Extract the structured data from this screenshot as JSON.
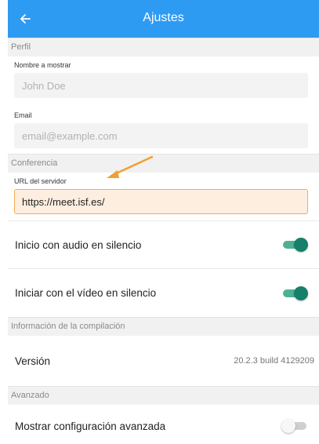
{
  "appbar": {
    "title": "Ajustes",
    "back_icon": "arrow-left-icon"
  },
  "profile": {
    "section_title": "Perfil",
    "display_name": {
      "label": "Nombre a mostrar",
      "placeholder": "John Doe",
      "value": ""
    },
    "email": {
      "label": "Email",
      "placeholder": "email@example.com",
      "value": ""
    }
  },
  "conference": {
    "section_title": "Conferencia",
    "server_url": {
      "label": "URL del servidor",
      "value": "https://meet.isf.es/"
    },
    "audio_muted": {
      "label": "Inicio con audio en silencio",
      "enabled": true
    },
    "video_muted": {
      "label": "Iniciar con el vídeo en silencio",
      "enabled": true
    }
  },
  "build_info": {
    "section_title": "Información de la compilación",
    "version_label": "Versión",
    "version_value": "20.2.3 build 4129209"
  },
  "advanced": {
    "section_title": "Avanzado",
    "show_advanced": {
      "label": "Mostrar configuración avanzada",
      "enabled": false
    }
  },
  "colors": {
    "appbar": "#2e9bf3",
    "switch_on": "#16806a",
    "highlight_border": "#f2ad55",
    "annotation_arrow": "#f0a030"
  }
}
